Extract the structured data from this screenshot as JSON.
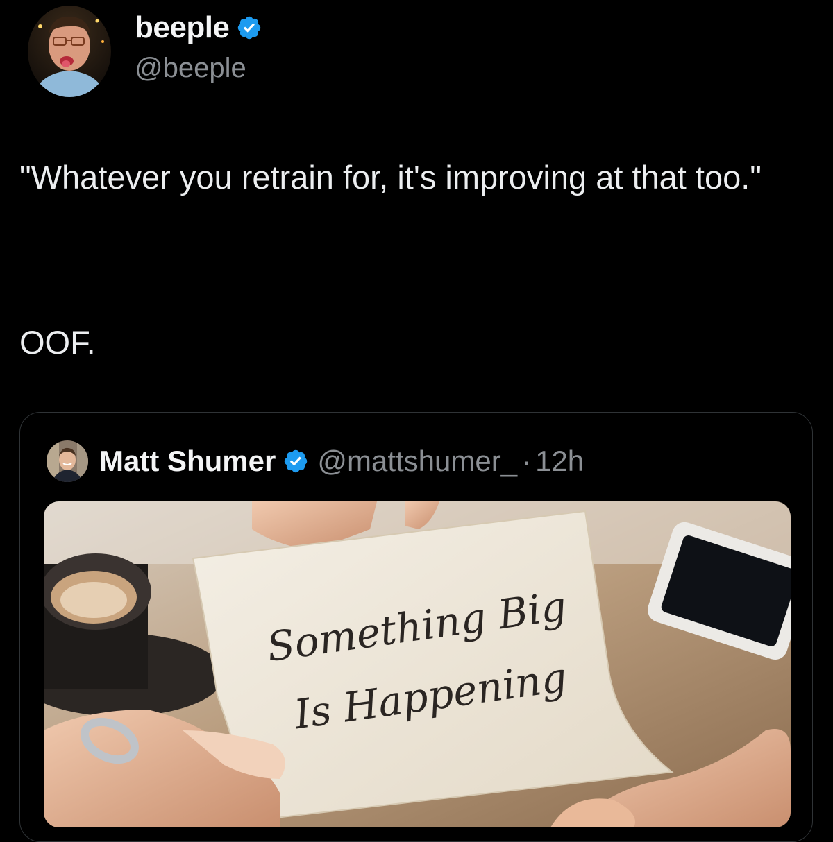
{
  "author": {
    "name": "beeple",
    "handle": "@beeple",
    "verified": true,
    "avatar_icon": "profile-photo"
  },
  "tweet": {
    "line1": "\"Whatever you retrain for, it's improving at that too.\"",
    "line2": "OOF."
  },
  "quoted_tweet": {
    "author_name": "Matt Shumer",
    "author_handle": "@mattshumer_",
    "separator": "·",
    "time": "12h",
    "verified": true,
    "media": {
      "description_icon": "note-photo",
      "note_line1": "Something Big",
      "note_line2": "Is Happening"
    }
  },
  "colors": {
    "background": "#000000",
    "verified_blue": "#1d9bf0",
    "secondary_text": "#8b8f94",
    "border": "#2f3336"
  }
}
